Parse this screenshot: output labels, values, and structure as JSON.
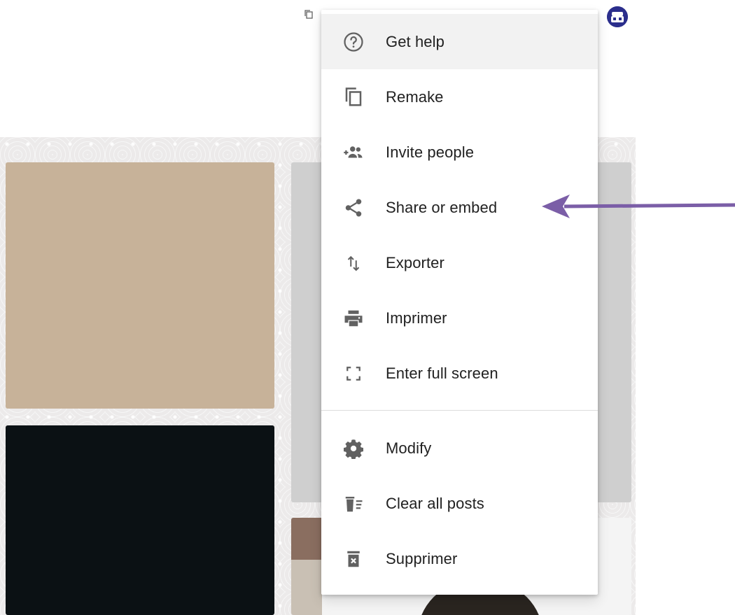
{
  "menu": {
    "items": [
      {
        "label": "Get help",
        "icon": "help-circle-icon"
      },
      {
        "label": "Remake",
        "icon": "copy-icon"
      },
      {
        "label": "Invite people",
        "icon": "add-people-icon"
      },
      {
        "label": "Share or embed",
        "icon": "share-icon"
      },
      {
        "label": "Exporter",
        "icon": "export-arrows-icon"
      },
      {
        "label": "Imprimer",
        "icon": "printer-icon"
      },
      {
        "label": "Enter full screen",
        "icon": "fullscreen-icon"
      }
    ],
    "secondary_items": [
      {
        "label": "Modify",
        "icon": "gear-icon"
      },
      {
        "label": "Clear all posts",
        "icon": "clear-posts-icon"
      },
      {
        "label": "Supprimer",
        "icon": "trash-icon"
      }
    ]
  },
  "colors": {
    "accent_arrow": "#7b5ea7",
    "avatar_bg": "#2b2e8c",
    "post_tan": "#c7b299",
    "post_black": "#0b1114"
  }
}
